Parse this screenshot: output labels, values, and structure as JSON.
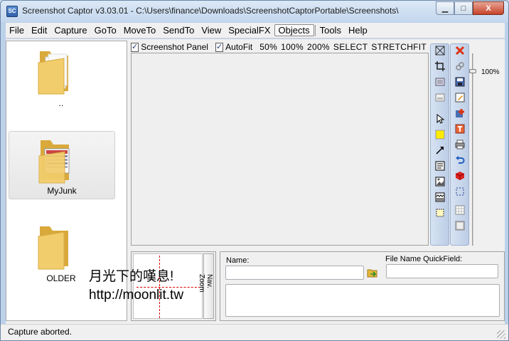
{
  "window": {
    "title": "Screenshot Captor v3.03.01 - C:\\Users\\finance\\Downloads\\ScreenshotCaptorPortable\\Screenshots\\",
    "app_icon_text": "SC",
    "minimize": "▁",
    "maximize": "□",
    "close": "X"
  },
  "menu": {
    "items": [
      "File",
      "Edit",
      "Capture",
      "GoTo",
      "MoveTo",
      "SendTo",
      "View",
      "SpecialFX",
      "Objects",
      "Tools",
      "Help"
    ]
  },
  "file_panel": {
    "folders": [
      {
        "label": ".."
      },
      {
        "label": "MyJunk"
      },
      {
        "label": "OLDER"
      }
    ]
  },
  "screenshot_panel": {
    "screenshot_panel_label": "Screenshot Panel",
    "screenshot_panel_checked": true,
    "autofit_label": "AutoFit",
    "autofit_checked": true,
    "zoom_options": [
      "50%",
      "100%",
      "200%",
      "SELECT",
      "STRETCHFIT"
    ],
    "check_mark": "✓"
  },
  "zoom_slider": {
    "value_label": "100%"
  },
  "nav_pane": {
    "nav_label": "Nav.",
    "zoom_label": "Zoom"
  },
  "info_pane": {
    "name_label": "Name:",
    "name_value": "",
    "quickfield_label": "File Name QuickField:",
    "quickfield_value": ""
  },
  "status": {
    "text": "Capture aborted."
  },
  "watermark": {
    "line1": "月光下的嘆息!",
    "line2": "http://moonlit.tw"
  },
  "colors": {
    "title_gradient_top": "#dbe8f6",
    "toolstrip": "#c9d8ee",
    "close_button": "#c7432a",
    "folder_yellow": "#f2cd6b"
  }
}
